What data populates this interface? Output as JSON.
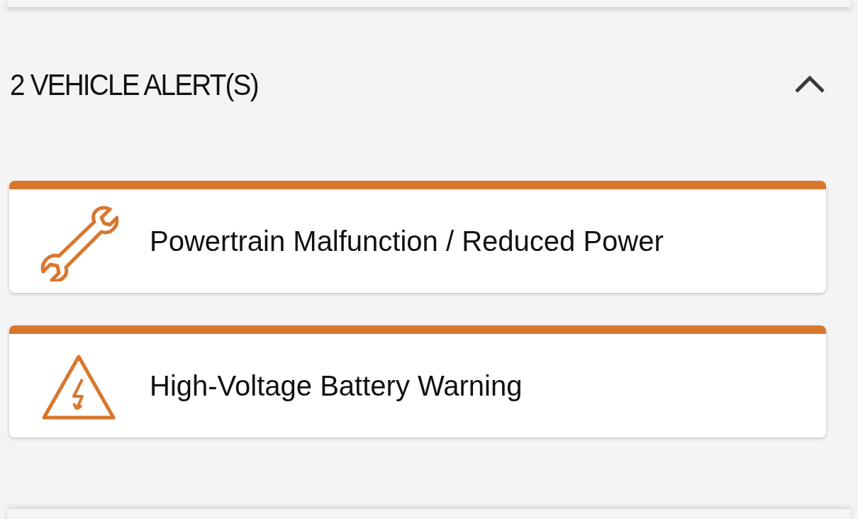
{
  "alerts_section": {
    "title": "2 VEHICLE ALERT(S)",
    "expanded": true,
    "alerts": [
      {
        "kind": "wrench",
        "label": "Powertrain Malfunction / Reduced Power"
      },
      {
        "kind": "electric",
        "label": "High-Voltage Battery Warning"
      }
    ]
  }
}
